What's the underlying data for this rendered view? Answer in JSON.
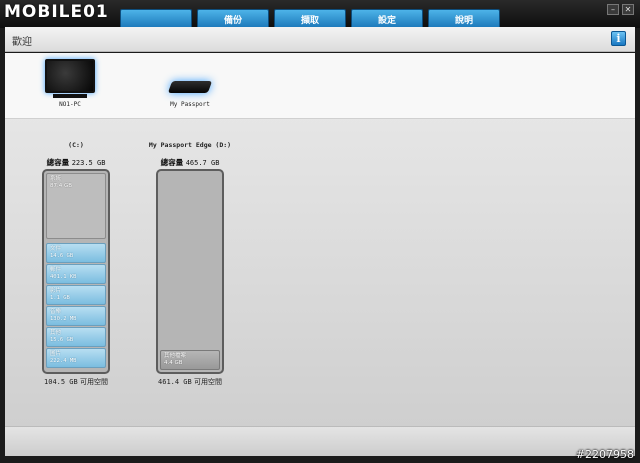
{
  "app": {
    "logo_text": "MOBILE01"
  },
  "tabs": [
    {
      "label": ""
    },
    {
      "label": "備份"
    },
    {
      "label": "擷取"
    },
    {
      "label": "設定"
    },
    {
      "label": "說明"
    }
  ],
  "window_buttons": {
    "minimize": "–",
    "close": "✕"
  },
  "header": {
    "title": "歡迎",
    "info_label": "i"
  },
  "devices": [
    {
      "label": "NO1-PC",
      "icon": "monitor-icon"
    },
    {
      "label": "My Passport",
      "icon": "external-drive-icon"
    }
  ],
  "volumes": [
    {
      "name": "(C:)",
      "total_label": "總容量",
      "total_value": "223.5 GB",
      "free_segment": {
        "label": "系統",
        "value": "87.4 GB"
      },
      "segments": [
        {
          "label": "文件",
          "value": "14.6 GB"
        },
        {
          "label": "郵件",
          "value": "401.1 KB"
        },
        {
          "label": "影片",
          "value": "1.1 GB"
        },
        {
          "label": "音樂",
          "value": "130.2 MB"
        },
        {
          "label": "其他",
          "value": "15.6 GB"
        },
        {
          "label": "圖片",
          "value": "222.4 MB"
        }
      ],
      "free_value": "104.5 GB",
      "free_label": "可用空間"
    },
    {
      "name": "My Passport Edge (D:)",
      "total_label": "總容量",
      "total_value": "465.7 GB",
      "other_segment": {
        "label": "其他檔案",
        "value": "4.4 GB"
      },
      "free_value": "461.4 GB",
      "free_label": "可用空間"
    }
  ],
  "watermark": "#2207958",
  "colors": {
    "tab": "#2f8fd0",
    "segment": "#9ccfea",
    "accent": "#1978c2"
  }
}
